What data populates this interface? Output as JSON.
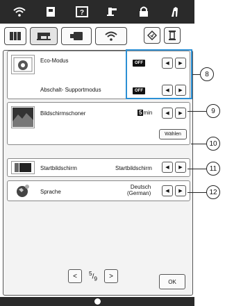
{
  "top_tabs": [
    {
      "icon": "wifi-icon"
    },
    {
      "icon": "page-icon"
    },
    {
      "icon": "help-icon"
    },
    {
      "icon": "foot-icon"
    },
    {
      "icon": "lock-icon"
    },
    {
      "icon": "needle-icon"
    }
  ],
  "sub_tabs": [
    {
      "icon": "general-settings-icon"
    },
    {
      "icon": "machine-icon"
    },
    {
      "icon": "embroidery-icon"
    },
    {
      "icon": "wlan-icon"
    }
  ],
  "settings": {
    "eco_label": "Eco-Modus",
    "eco_value": "OFF",
    "shutoff_label": "Abschalt- Supportmodus",
    "shutoff_value": "OFF",
    "screensaver_label": "Bildschirmschoner",
    "screensaver_value_num": "5",
    "screensaver_value_unit": "min",
    "choose_label": "Wählen",
    "startscreen_label": "Startbildschirm",
    "startscreen_value": "Startbildschirm",
    "language_label": "Sprache",
    "language_value_line1": "Deutsch",
    "language_value_line2": "(German)"
  },
  "arrows": {
    "left": "◀",
    "right": "▶"
  },
  "pager": {
    "prev": "<",
    "next": ">",
    "current": "5",
    "total": "9"
  },
  "ok_label": "OK",
  "callouts": {
    "c8": "8",
    "c9": "9",
    "c10": "10",
    "c11": "11",
    "c12": "12"
  },
  "colors": {
    "highlight": "#2b8fd4",
    "bar": "#2a2a2a"
  }
}
